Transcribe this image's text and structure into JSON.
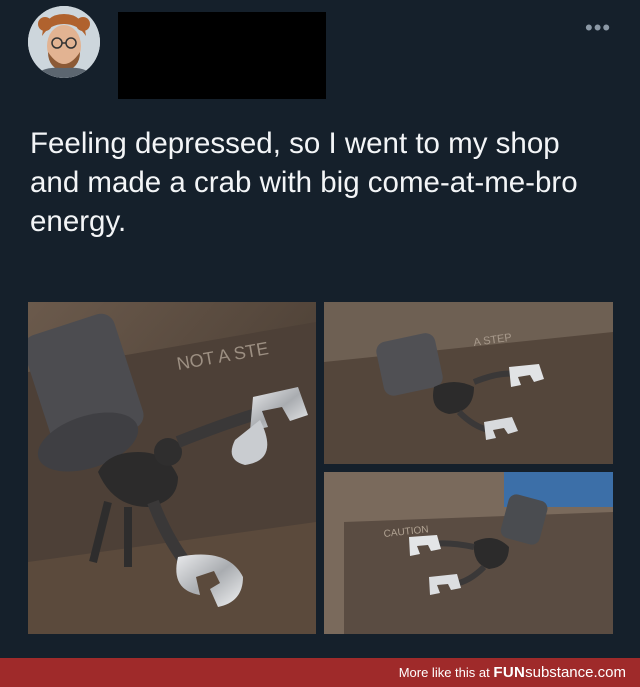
{
  "tweet": {
    "text": "Feeling depressed, so I went to my shop and made a crab with big come-at-me-bro energy.",
    "more_icon": "more-horizontal-icon",
    "photos": [
      {
        "stamp": "NOT A STE"
      },
      {
        "stamp": "A STEP"
      },
      {
        "stamp": "CAUTION"
      }
    ]
  },
  "footer": {
    "prefix": "More like this at",
    "brand_bold": "FUN",
    "brand_light": "substance.com",
    "color": "#9f2a2a"
  }
}
